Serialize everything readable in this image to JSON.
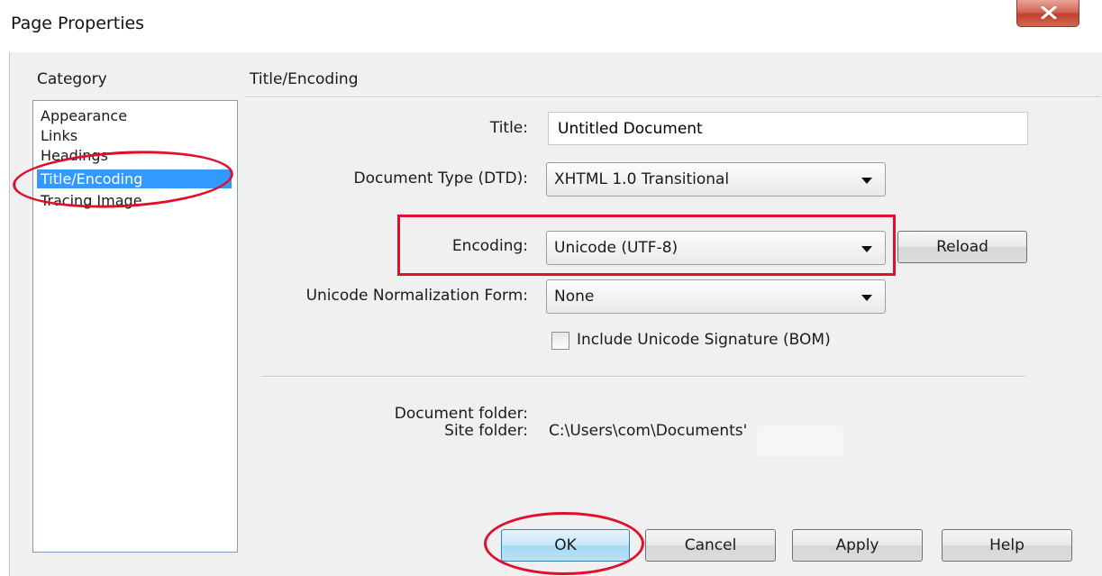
{
  "window": {
    "title": "Page Properties",
    "close_icon": "close-icon"
  },
  "category": {
    "label": "Category",
    "items": [
      {
        "label": "Appearance",
        "selected": false
      },
      {
        "label": "Links",
        "selected": false
      },
      {
        "label": "Headings",
        "selected": false
      },
      {
        "label": "Title/Encoding",
        "selected": true
      },
      {
        "label": "Tracing Image",
        "selected": false
      }
    ]
  },
  "section": {
    "title": "Title/Encoding",
    "title_label": "Title:",
    "title_value": "Untitled Document",
    "doctype_label": "Document Type (DTD):",
    "doctype_value": "XHTML 1.0 Transitional",
    "encoding_label": "Encoding:",
    "encoding_value": "Unicode (UTF-8)",
    "reload_label": "Reload",
    "normalization_label": "Unicode Normalization Form:",
    "normalization_value": "None",
    "bom_label": "Include Unicode Signature (BOM)",
    "bom_checked": false,
    "doc_folder_label": "Document folder:",
    "doc_folder_value": "",
    "site_folder_label": "Site folder:",
    "site_folder_value": "C:\\Users\\com\\Documents'"
  },
  "buttons": {
    "ok": "OK",
    "cancel": "Cancel",
    "apply": "Apply",
    "help": "Help"
  },
  "colors": {
    "selection": "#3399ff",
    "annotation": "#e0102c",
    "dialog_bg": "#f0f0f0"
  }
}
